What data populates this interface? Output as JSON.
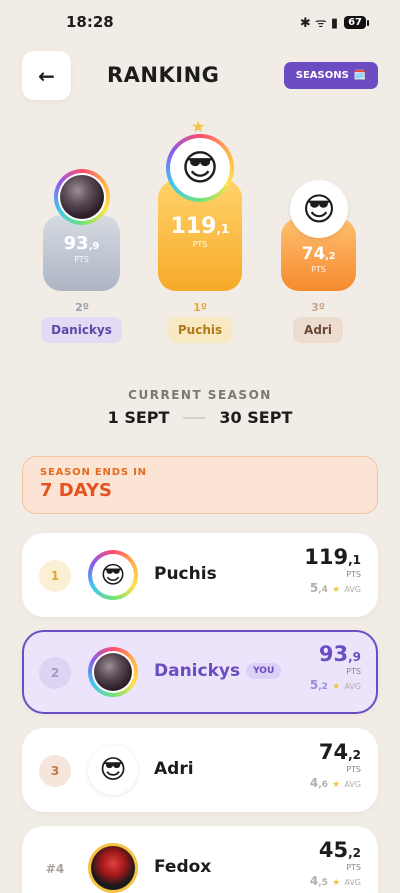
{
  "status_bar": {
    "time": "18:28",
    "icons": "✱ ᯤ ▮",
    "battery": "67"
  },
  "header": {
    "title": "RANKING",
    "seasons_label": "SEASONS",
    "seasons_icon": "🗓️"
  },
  "podium": [
    {
      "place": "2º",
      "name": "Danickys",
      "score_int": "93",
      "score_dec": ",9",
      "pts_label": "PTS"
    },
    {
      "place": "1º",
      "name": "Puchis",
      "score_int": "119",
      "score_dec": ",1",
      "pts_label": "PTS"
    },
    {
      "place": "3º",
      "name": "Adri",
      "score_int": "74",
      "score_dec": ",2",
      "pts_label": "PTS"
    }
  ],
  "season": {
    "label": "CURRENT SEASON",
    "start": "1 SEPT",
    "end": "30 SEPT"
  },
  "ends": {
    "label": "SEASON ENDS IN",
    "value": "7 DAYS"
  },
  "rows": [
    {
      "pos": "1",
      "name": "Puchis",
      "score_int": "119",
      "score_dec": ",1",
      "pts_label": "PTS",
      "avg_int": "5",
      "avg_dec": ",4",
      "avg_label": "AVG",
      "you": ""
    },
    {
      "pos": "2",
      "name": "Danickys",
      "score_int": "93",
      "score_dec": ",9",
      "pts_label": "PTS",
      "avg_int": "5",
      "avg_dec": ",2",
      "avg_label": "AVG",
      "you": "YOU"
    },
    {
      "pos": "3",
      "name": "Adri",
      "score_int": "74",
      "score_dec": ",2",
      "pts_label": "PTS",
      "avg_int": "4",
      "avg_dec": ",6",
      "avg_label": "AVG",
      "you": ""
    },
    {
      "pos": "#4",
      "name": "Fedox",
      "score_int": "45",
      "score_dec": ",2",
      "pts_label": "PTS",
      "avg_int": "4",
      "avg_dec": ",5",
      "avg_label": "AVG",
      "you": ""
    }
  ],
  "emoji": {
    "cool": "😎",
    "star": "★",
    "back_arrow": "←"
  },
  "colors": {
    "accent": "#6b4cc2",
    "gold": "#f7a928",
    "orange": "#e5521f",
    "silver": "#b9c0cc"
  }
}
